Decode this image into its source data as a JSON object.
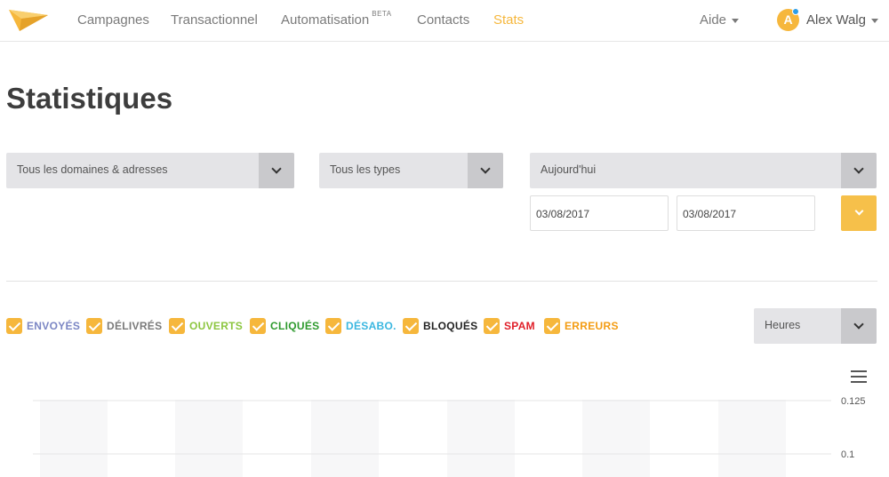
{
  "nav": {
    "items": [
      {
        "label": "Campagnes",
        "active": false
      },
      {
        "label": "Transactionnel",
        "active": false
      },
      {
        "label": "Automatisation",
        "badge": "BETA",
        "active": false
      },
      {
        "label": "Contacts",
        "active": false
      },
      {
        "label": "Stats",
        "active": true
      }
    ],
    "help_label": "Aide",
    "user_initial": "A",
    "user_name": "Alex Walg",
    "accent_color": "#f6b73c"
  },
  "page_title": "Statistiques",
  "filters": {
    "domain_select": "Tous les domaines & adresses",
    "type_select": "Tous les types",
    "period_select": "Aujourd'hui",
    "date_from": "03/08/2017",
    "date_to": "03/08/2017",
    "granularity_select": "Heures"
  },
  "metrics": [
    {
      "label": "ENVOYÉS",
      "checked": true,
      "color": "#7b86c4"
    },
    {
      "label": "DÉLIVRÉS",
      "checked": true,
      "color": "#7a7a7a"
    },
    {
      "label": "OUVERTS",
      "checked": true,
      "color": "#8cc63f"
    },
    {
      "label": "CLIQUÉS",
      "checked": true,
      "color": "#2e9a2e"
    },
    {
      "label": "DÉSABO.",
      "checked": true,
      "color": "#3bb7e0"
    },
    {
      "label": "BLOQUÉS",
      "checked": true,
      "color": "#222222"
    },
    {
      "label": "SPAM",
      "checked": true,
      "color": "#e0202a"
    },
    {
      "label": "ERREURS",
      "checked": true,
      "color": "#f39c12"
    }
  ],
  "chart_data": {
    "type": "bar",
    "y_ticks": [
      "0.125",
      "0.1"
    ],
    "ylim_visible": [
      0.1,
      0.125
    ],
    "grid": true,
    "series": []
  }
}
